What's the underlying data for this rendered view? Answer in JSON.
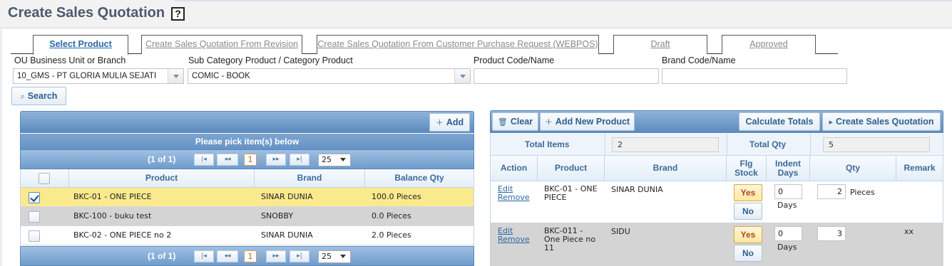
{
  "page": {
    "title": "Create Sales Quotation",
    "help_icon": "?"
  },
  "tabs": [
    {
      "label": "Select Product",
      "active": true
    },
    {
      "label": "Create Sales Quotation From Revision",
      "active": false
    },
    {
      "label": "Create Sales Quotation From Customer Purchase Request (WEBPOS)",
      "active": false
    },
    {
      "label": "Draft",
      "active": false
    },
    {
      "label": "Approved",
      "active": false
    }
  ],
  "filters": {
    "ou_label": "OU Business Unit or Branch",
    "ou_value": "10_GMS - PT GLORIA MULIA SEJATI",
    "category_label": "Sub Category Product / Category Product",
    "category_value": "COMIC - BOOK",
    "product_label": "Product Code/Name",
    "product_value": "",
    "brand_label": "Brand Code/Name",
    "brand_value": "",
    "search_label": "Search"
  },
  "left_panel": {
    "add_label": "Add",
    "pick_heading": "Please pick item(s) below",
    "pager": {
      "text": "(1 of 1)",
      "current_page": "1",
      "page_size": "25"
    },
    "columns": [
      "Product",
      "Brand",
      "Balance Qty"
    ],
    "rows": [
      {
        "product": "BKC-01 - ONE PIECE",
        "brand": "SINAR DUNIA",
        "balance": "100.0 Pieces",
        "checked": true
      },
      {
        "product": "BKC-100 - buku test",
        "brand": "SNOBBY",
        "balance": "0.0 Pieces",
        "checked": false
      },
      {
        "product": "BKC-02 - ONE PIECE no 2",
        "brand": "SINAR DUNIA",
        "balance": "2.0 Pieces",
        "checked": false
      }
    ]
  },
  "right_panel": {
    "clear_label": "Clear",
    "add_new_label": "Add New Product",
    "calc_label": "Calculate Totals",
    "create_label": "Create Sales Quotation",
    "total_items_label": "Total Items",
    "total_items_value": "2",
    "total_qty_label": "Total Qty",
    "total_qty_value": "5",
    "columns": {
      "action": "Action",
      "product": "Product",
      "brand": "Brand",
      "flg": "Flg Stock",
      "indent": "Indent Days",
      "qty": "Qty",
      "remark": "Remark"
    },
    "rows": [
      {
        "edit": "Edit",
        "remove": "Remove",
        "product": "BKC-01 - ONE PIECE",
        "brand": "SINAR DUNIA",
        "yes": "Yes",
        "no": "No",
        "indent": "0",
        "days": "Days",
        "qty": "2",
        "unit": "Pieces",
        "remark": ""
      },
      {
        "edit": "Edit",
        "remove": "Remove",
        "product": "BKC-011 - One Piece no 11",
        "brand": "SIDU",
        "yes": "Yes",
        "no": "No",
        "indent": "0",
        "days": "Days",
        "qty": "3",
        "unit": "",
        "remark": "xx"
      }
    ]
  },
  "colors": {
    "accent": "#2a68a6",
    "bar": "#6f9bcb",
    "selected_row": "#fbe98e",
    "alt_row": "#d4d4d4"
  }
}
